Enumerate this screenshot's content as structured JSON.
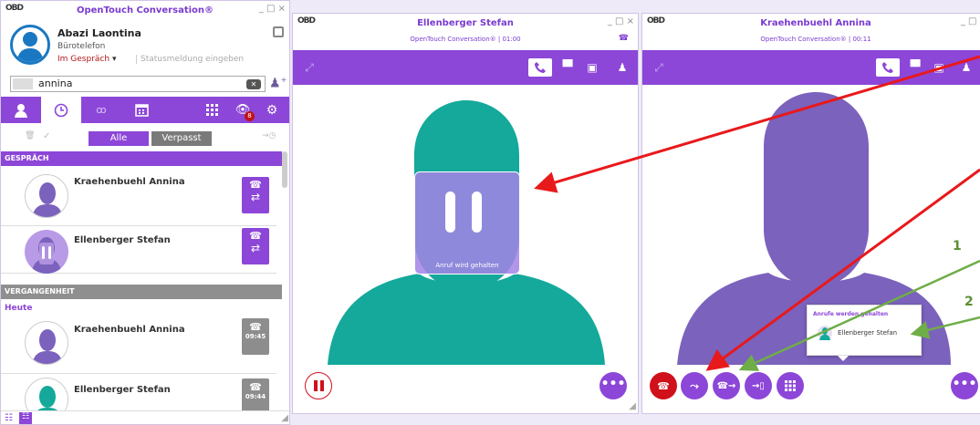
{
  "left_window": {
    "logo": "OBD",
    "title": "OpenTouch Conversation®",
    "controls": "_ □ ×",
    "user_name": "Abazi Laontina",
    "device": "Bürotelefon",
    "status": "Im Gespräch",
    "status_placeholder": "Statusmeldung eingeben",
    "search_value": "annina",
    "tab_badge": "8",
    "filter_all": "Alle",
    "filter_missed": "Verpasst",
    "section_current": "GESPRÄCH",
    "section_past": "VERGANGENHEIT",
    "today_label": "Heute",
    "contacts": [
      {
        "name": "Kraehenbuehl Annina"
      },
      {
        "name": "Ellenberger Stefan"
      }
    ],
    "history": [
      {
        "name": "Kraehenbuehl Annina",
        "time": "09:45"
      },
      {
        "name": "Ellenberger Stefan",
        "time": "09:44"
      }
    ]
  },
  "middle_window": {
    "logo": "OBD",
    "title": "Ellenberger Stefan",
    "subtitle": "OpenTouch Conversation® | 01:00",
    "controls": "_ □ ×",
    "hold_text": "Anruf wird gehalten"
  },
  "right_window": {
    "logo": "OBD",
    "title": "Kraehenbuehl Annina",
    "subtitle": "OpenTouch Conversation® | 00:11",
    "controls": "_ □ ×",
    "popup_title": "Anrufe werden gehalten",
    "popup_name": "Ellenberger Stefan"
  },
  "annotations": {
    "label_1": "1",
    "label_2": "2"
  },
  "colors": {
    "accent": "#8c46d8",
    "teal": "#14a99b",
    "avatar_purple": "#7b62bd",
    "hangup_red": "#d0101a",
    "arrow_red": "#e8191b",
    "arrow_green": "#6fad47"
  }
}
